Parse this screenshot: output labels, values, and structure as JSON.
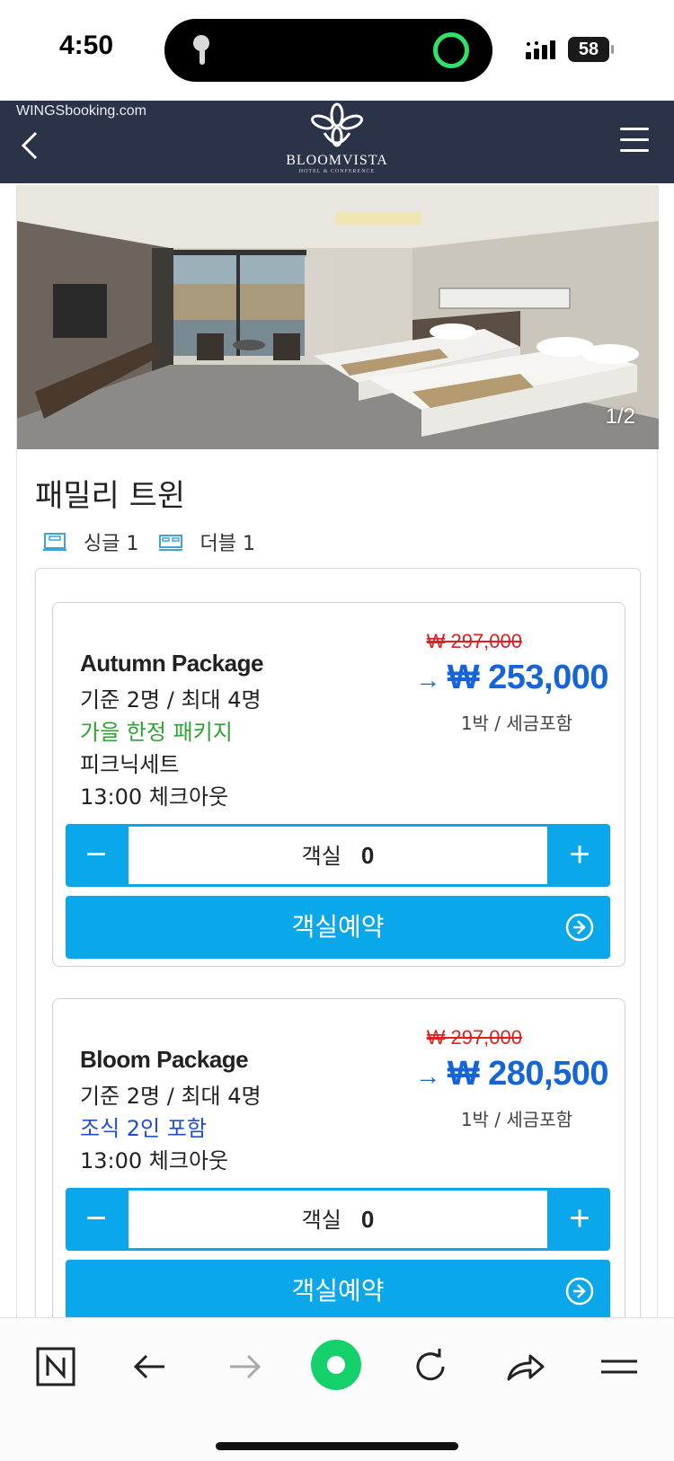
{
  "status_bar": {
    "time": "4:50",
    "battery": "58"
  },
  "header": {
    "site_domain": "WINGSbooking.com",
    "logo_name": "BLOOMVISTA",
    "logo_sub": "HOTEL & CONFERENCE"
  },
  "room": {
    "photo_counter": "1/2",
    "title": "패밀리 트윈",
    "beds": [
      {
        "icon": "single-bed-icon",
        "label": "싱글 1"
      },
      {
        "icon": "double-bed-icon",
        "label": "더블 1"
      }
    ]
  },
  "packages": [
    {
      "name": "Autumn Package",
      "occupancy": "기준 2명 / 최대 4명",
      "highlight": "가을 한정 패키지",
      "highlight_color": "#2ea333",
      "extras": [
        "피크닉세트",
        "13:00 체크아웃"
      ],
      "original_price": "₩ 297,000",
      "arrow": "→",
      "price": "₩ 253,000",
      "price_note": "1박 / 세금포함",
      "qty_label": "객실",
      "qty_value": "0",
      "book_label": "객실예약"
    },
    {
      "name": "Bloom Package",
      "occupancy": "기준 2명 / 최대 4명",
      "highlight": "조식 2인 포함",
      "highlight_color": "#1f4fd8",
      "extras": [
        "13:00 체크아웃"
      ],
      "original_price": "₩ 297,000",
      "arrow": "→",
      "price": "₩ 280,500",
      "price_note": "1박 / 세금포함",
      "qty_label": "객실",
      "qty_value": "0",
      "book_label": "객실예약"
    }
  ],
  "qty_controls": {
    "minus": "−",
    "plus": "+"
  },
  "colors": {
    "header_bg": "#2b3348",
    "accent": "#0aa7ea",
    "price": "#1565d8",
    "old_price": "#e02020"
  },
  "toolbar": {
    "icons": [
      "naver-n-icon",
      "back-arrow-icon",
      "forward-arrow-icon",
      "naver-green-dot-icon",
      "reload-icon",
      "share-icon",
      "menu-icon"
    ]
  }
}
